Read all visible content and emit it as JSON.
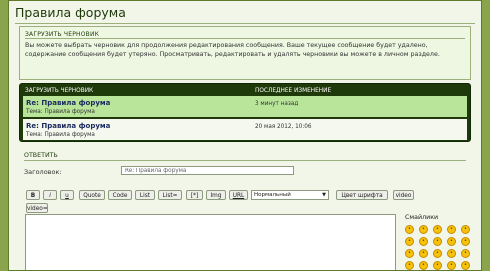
{
  "page": {
    "title": "Правила форума"
  },
  "load_draft": {
    "heading": "ЗАГРУЗИТЬ ЧЕРНОВИК",
    "description": "Вы можете выбрать черновик для продолжения редактирования сообщения. Ваше текущее сообщение будет удалено, содержание сообщения будет утеряно. Просматривать, редактировать и удалять черновики вы можете в личном разделе."
  },
  "drafts_table": {
    "col_draft": "ЗАГРУЗИТЬ ЧЕРНОВИК",
    "col_modified": "ПОСЛЕДНЕЕ ИЗМЕНЕНИЕ",
    "rows": [
      {
        "title": "Re: Правила форума",
        "topic": "Тема: Правила форума",
        "time": "3 минут назад"
      },
      {
        "title": "Re: Правила форума",
        "topic": "Тема: Правила форума",
        "time": "20 мая 2012, 10:06"
      }
    ]
  },
  "reply": {
    "heading": "ОТВЕТИТЬ",
    "subject_label": "Заголовок:",
    "subject_value": "Re: Правила форума"
  },
  "toolbar": {
    "buttons": [
      "B",
      "i",
      "u",
      "Quote",
      "Code",
      "List",
      "List=",
      "[*]",
      "Img",
      "URL"
    ],
    "font_size": "Нормальный",
    "color_button": "Цвет шрифта",
    "video_button": "video",
    "video_eq_button": "video="
  },
  "smilies": {
    "title": "Смайлики",
    "items": [
      "smile-icon",
      "wink-icon",
      "grin-icon",
      "tongue-icon",
      "cool-icon",
      "happy-icon",
      "laugh-icon",
      "surprised-icon",
      "confused-icon",
      "sad-icon",
      "angry-icon",
      "shock-icon",
      "blush-icon",
      "evil-icon",
      "eek-icon",
      "smile-icon",
      "wink-icon",
      "grin-icon",
      "tongue-icon",
      "cool-icon"
    ]
  }
}
